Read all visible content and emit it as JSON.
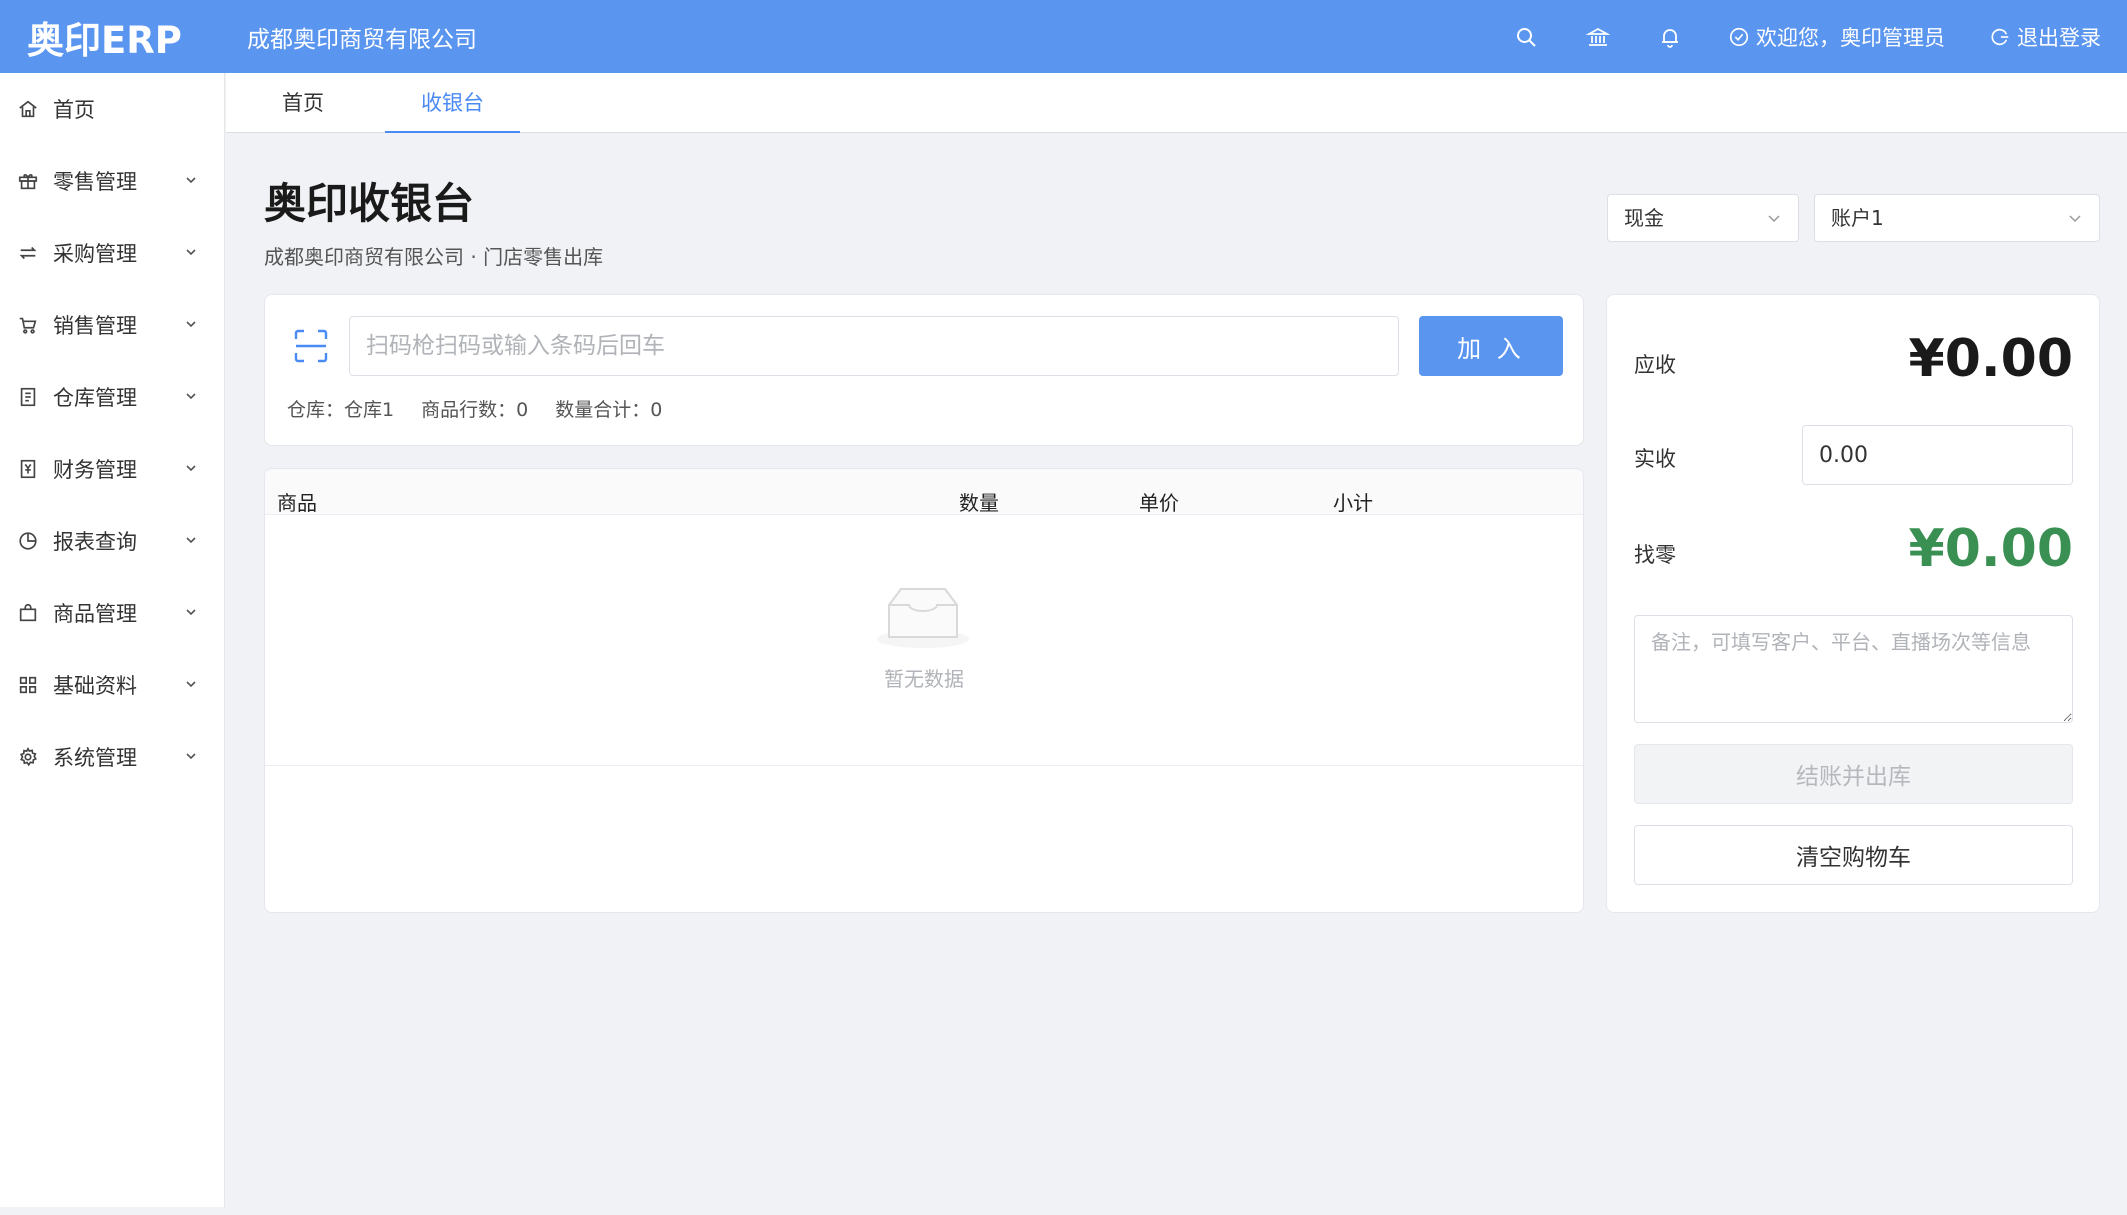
{
  "header": {
    "logo": "奥印ERP",
    "company": "成都奥印商贸有限公司",
    "welcome": "欢迎您，奥印管理员",
    "logout": "退出登录",
    "bg_color": "#5a95f0"
  },
  "sidebar": {
    "items": [
      {
        "label": "首页",
        "icon": "home-icon"
      },
      {
        "label": "零售管理",
        "icon": "gift-icon"
      },
      {
        "label": "采购管理",
        "icon": "swap-icon"
      },
      {
        "label": "销售管理",
        "icon": "cart-icon"
      },
      {
        "label": "仓库管理",
        "icon": "notebook-icon"
      },
      {
        "label": "财务管理",
        "icon": "yen-icon"
      },
      {
        "label": "报表查询",
        "icon": "pie-chart-icon"
      },
      {
        "label": "商品管理",
        "icon": "bag-icon"
      },
      {
        "label": "基础资料",
        "icon": "grid-icon"
      },
      {
        "label": "系统管理",
        "icon": "gear-icon"
      }
    ]
  },
  "tabs": [
    {
      "label": "首页",
      "active": false
    },
    {
      "label": "收银台",
      "active": true
    }
  ],
  "page": {
    "title": "奥印收银台",
    "subtitle": "成都奥印商贸有限公司 · 门店零售出库"
  },
  "selects": {
    "payment_method": "现金",
    "account": "账户1"
  },
  "scan": {
    "placeholder": "扫码枪扫码或输入条码后回车",
    "add_label": "加 入",
    "warehouse_label": "仓库：",
    "warehouse_value": "仓库1",
    "rows_label": "商品行数：",
    "rows_value": "0",
    "qty_label": "数量合计：",
    "qty_value": "0"
  },
  "table": {
    "columns": [
      "商品",
      "数量",
      "单价",
      "小计"
    ],
    "rows": [],
    "empty_text": "暂无数据"
  },
  "payment": {
    "receivable_label": "应收",
    "receivable_value": "¥0.00",
    "received_label": "实收",
    "received_value": "0.00",
    "change_label": "找零",
    "change_value": "¥0.00",
    "change_color": "#3a8f52",
    "note_placeholder": "备注，可填写客户、平台、直播场次等信息",
    "checkout_label": "结账并出库",
    "clear_label": "清空购物车"
  }
}
